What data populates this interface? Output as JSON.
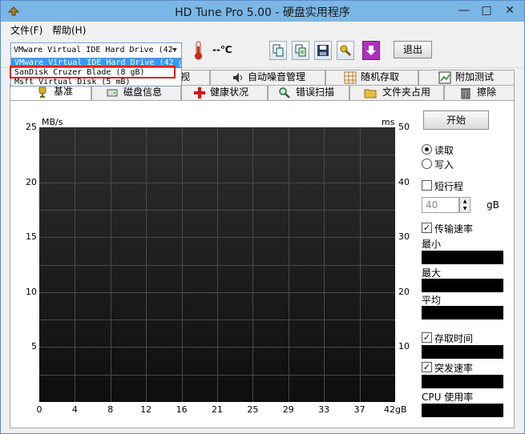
{
  "window": {
    "title": "HD Tune Pro 5.00 - 硬盘实用程序",
    "minimize": "—",
    "maximize": "□",
    "close": "✕"
  },
  "menu": {
    "file": "文件(F)",
    "help": "帮助(H)"
  },
  "toolbar": {
    "drive_selected": "VMware Virtual IDE Hard Drive (42",
    "temperature": "--℃",
    "exit_label": "退出"
  },
  "dropdown": {
    "items": [
      "VMware Virtual IDE Hard Drive (42 gB)",
      "SanDisk Cruzer Blade      (8 gB)",
      "Msft    Virtual Disk      (5 mB)"
    ],
    "selected_index": 0
  },
  "tabs_top": [
    {
      "label": "视",
      "icon": "info-icon"
    },
    {
      "label": "自动噪音管理",
      "icon": "speaker-icon"
    },
    {
      "label": "随机存取",
      "icon": "grid-icon"
    },
    {
      "label": "附加测试",
      "icon": "chart-icon"
    }
  ],
  "tabs_bottom": [
    {
      "label": "基准",
      "icon": "trophy-icon"
    },
    {
      "label": "磁盘信息",
      "icon": "disk-icon"
    },
    {
      "label": "健康状况",
      "icon": "plus-icon"
    },
    {
      "label": "错误扫描",
      "icon": "magnifier-icon"
    },
    {
      "label": "文件夹占用",
      "icon": "folder-icon"
    },
    {
      "label": "擦除",
      "icon": "trash-icon"
    }
  ],
  "chart_data": {
    "type": "line",
    "ylabel_left": "MB/s",
    "ylabel_right": "ms",
    "y_left_ticks": [
      "25",
      "20",
      "15",
      "10",
      "5"
    ],
    "y_right_ticks": [
      "50",
      "40",
      "30",
      "20",
      "10"
    ],
    "x_ticks": [
      "0",
      "4",
      "8",
      "12",
      "16",
      "21",
      "25",
      "29",
      "33",
      "37",
      "42gB"
    ],
    "ylim_left": [
      0,
      25
    ],
    "ylim_right": [
      0,
      50
    ],
    "xlim": [
      0,
      42
    ],
    "grid": true,
    "series": []
  },
  "controls": {
    "start_label": "开始",
    "read_label": "读取",
    "write_label": "写入",
    "short_stroke_label": "短行程",
    "short_stroke_value": "40",
    "short_stroke_unit": "gB",
    "transfer_rate_label": "传输速率",
    "min_label": "最小",
    "max_label": "最大",
    "avg_label": "平均",
    "access_time_label": "存取时间",
    "burst_rate_label": "突发速率",
    "cpu_label": "CPU 使用率",
    "check": "✓"
  }
}
